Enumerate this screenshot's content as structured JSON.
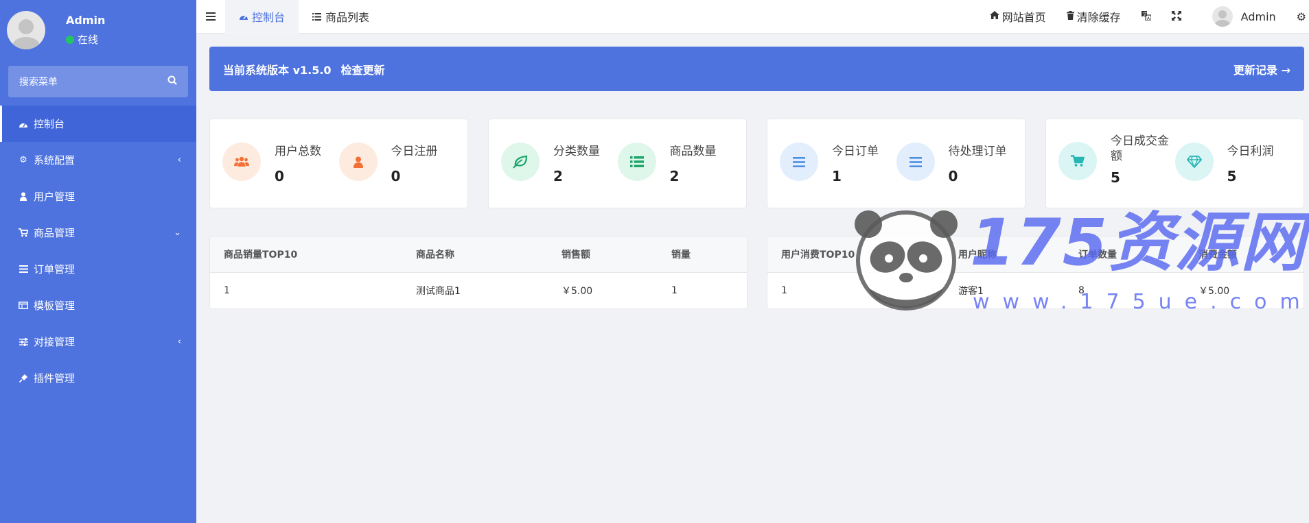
{
  "sidebar": {
    "user_name": "Admin",
    "user_status": "在线",
    "search_placeholder": "搜索菜单",
    "items": [
      {
        "label": "控制台",
        "icon": "dashboard-icon",
        "active": true
      },
      {
        "label": "系统配置",
        "icon": "gear-icon",
        "arrow": "‹"
      },
      {
        "label": "用户管理",
        "icon": "user-icon"
      },
      {
        "label": "商品管理",
        "icon": "cart-icon",
        "arrow": "⌄"
      },
      {
        "label": "订单管理",
        "icon": "list-icon"
      },
      {
        "label": "模板管理",
        "icon": "template-icon"
      },
      {
        "label": "对接管理",
        "icon": "sliders-icon",
        "arrow": "‹"
      },
      {
        "label": "插件管理",
        "icon": "plug-icon"
      }
    ]
  },
  "topnav": {
    "tabs": [
      {
        "label": "控制台",
        "icon": "dashboard-icon",
        "active": true
      },
      {
        "label": "商品列表",
        "icon": "list-icon"
      }
    ],
    "home_label": "网站首页",
    "clear_cache_label": "清除缓存",
    "user_name": "Admin"
  },
  "banner": {
    "version_text": "当前系统版本 v1.5.0",
    "check_update": "检查更新",
    "changelog": "更新记录 →"
  },
  "stats": [
    {
      "label": "用户总数",
      "value": "0",
      "icon": "users-icon",
      "color": "#f36f35"
    },
    {
      "label": "今日注册",
      "value": "0",
      "icon": "user-icon",
      "color": "#f36f35"
    },
    {
      "label": "分类数量",
      "value": "2",
      "icon": "leaf-icon",
      "color": "#1ea56a"
    },
    {
      "label": "商品数量",
      "value": "2",
      "icon": "list-icon",
      "color": "#1ea56a"
    },
    {
      "label": "今日订单",
      "value": "1",
      "icon": "bars-icon",
      "color": "#4b8ee6"
    },
    {
      "label": "待处理订单",
      "value": "0",
      "icon": "bars-icon",
      "color": "#4b8ee6"
    },
    {
      "label": "今日成交金额",
      "value": "5",
      "icon": "cart-icon",
      "color": "#26b6b4"
    },
    {
      "label": "今日利润",
      "value": "5",
      "icon": "diamond-icon",
      "color": "#26b6b4"
    }
  ],
  "goods_table": {
    "headers": [
      "商品销量TOP10",
      "商品名称",
      "销售额",
      "销量"
    ],
    "rows": [
      [
        "1",
        "测试商品1",
        "￥5.00",
        "1"
      ]
    ]
  },
  "users_table": {
    "headers": [
      "用户消费TOP10",
      "用户昵称",
      "订单数量",
      "消费金额"
    ],
    "rows": [
      [
        "1",
        "游客1",
        "8",
        "￥5.00"
      ]
    ]
  },
  "watermark": {
    "title": "175资源网",
    "url": "www.175ue.com"
  }
}
